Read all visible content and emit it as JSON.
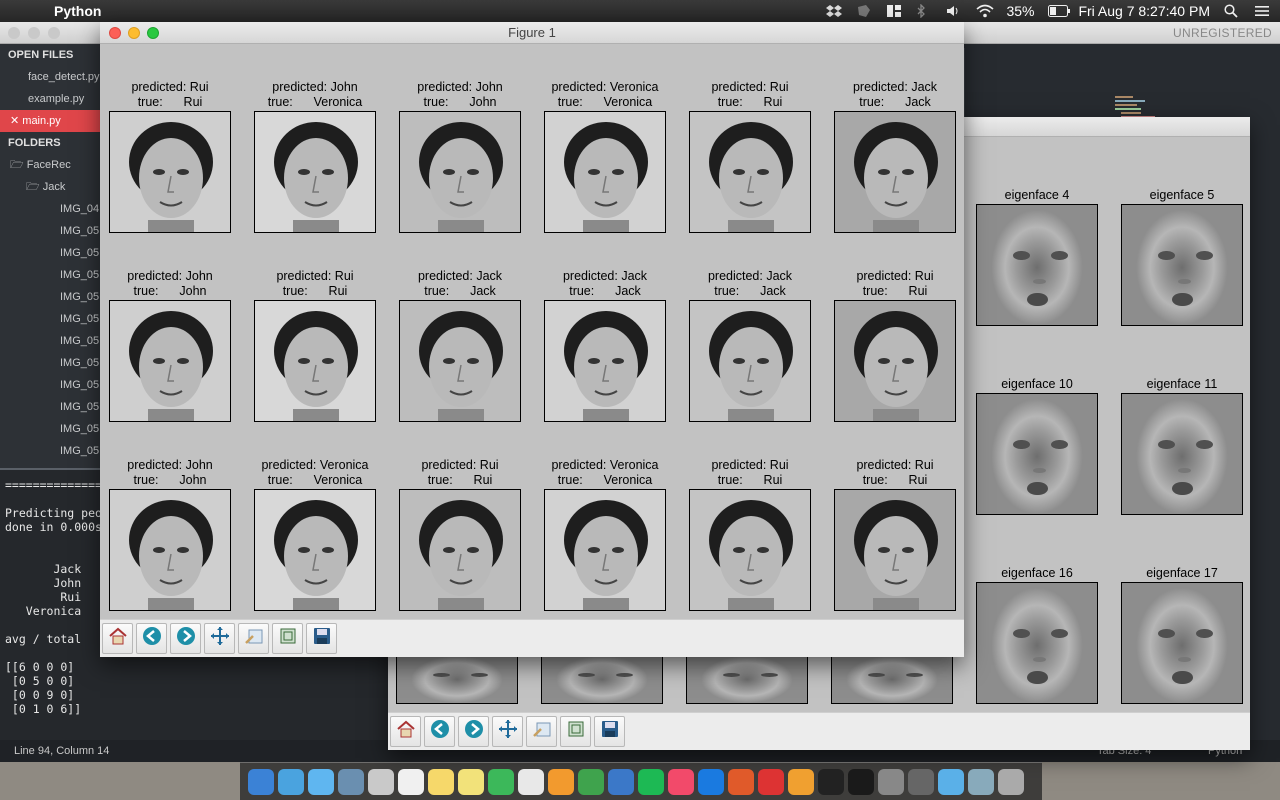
{
  "menubar": {
    "app_name": "Python",
    "battery": "35%",
    "clock": "Fri Aug 7  8:27:40 PM"
  },
  "editor": {
    "unregistered": "UNREGISTERED",
    "sidebar": {
      "open_files_header": "OPEN FILES",
      "open_files": [
        "face_detect.py",
        "example.py",
        "main.py"
      ],
      "active_file": "main.py",
      "folders_header": "FOLDERS",
      "folder_root": "FaceRec",
      "folder_child": "Jack",
      "files": [
        "IMG_04",
        "IMG_05",
        "IMG_05",
        "IMG_05",
        "IMG_05",
        "IMG_05",
        "IMG_05",
        "IMG_05",
        "IMG_05",
        "IMG_05",
        "IMG_05",
        "IMG_05",
        "IMG_05"
      ]
    },
    "console_text": "==================\n\nPredicting peo\ndone in 0.000s\n              P\n\n       Jack\n       John\n        Rui\n   Veronica\n\navg / total\n\n[[6 0 0 0]\n [0 5 0 0]\n [0 0 9 0]\n [0 1 0 6]]",
    "status_left": "Line 94, Column 14",
    "status_tabsize": "Tab Size: 4",
    "status_syntax": "Python"
  },
  "figure1": {
    "title": "Figure 1",
    "panels": [
      {
        "predicted": "predicted: Rui",
        "true": "true:      Rui"
      },
      {
        "predicted": "predicted: John",
        "true": "true:      Veronica"
      },
      {
        "predicted": "predicted: John",
        "true": "true:      John"
      },
      {
        "predicted": "predicted: Veronica",
        "true": "true:      Veronica"
      },
      {
        "predicted": "predicted: Rui",
        "true": "true:      Rui"
      },
      {
        "predicted": "predicted: Jack",
        "true": "true:      Jack"
      },
      {
        "predicted": "predicted: John",
        "true": "true:      John"
      },
      {
        "predicted": "predicted: Rui",
        "true": "true:      Rui"
      },
      {
        "predicted": "predicted: Jack",
        "true": "true:      Jack"
      },
      {
        "predicted": "predicted: Jack",
        "true": "true:      Jack"
      },
      {
        "predicted": "predicted: Jack",
        "true": "true:      Jack"
      },
      {
        "predicted": "predicted: Rui",
        "true": "true:      Rui"
      },
      {
        "predicted": "predicted: John",
        "true": "true:      John"
      },
      {
        "predicted": "predicted: Veronica",
        "true": "true:      Veronica"
      },
      {
        "predicted": "predicted: Rui",
        "true": "true:      Rui"
      },
      {
        "predicted": "predicted: Veronica",
        "true": "true:      Veronica"
      },
      {
        "predicted": "predicted: Rui",
        "true": "true:      Rui"
      },
      {
        "predicted": "predicted: Rui",
        "true": "true:      Rui"
      }
    ],
    "toolbar": [
      "home-icon",
      "back-arrow-icon",
      "forward-arrow-icon",
      "pan-icon",
      "zoom-icon",
      "subplots-icon",
      "save-icon"
    ]
  },
  "figure2": {
    "eigenface_labels": [
      "eigenface 4",
      "eigenface 5",
      "eigenface 10",
      "eigenface 11",
      "eigenface 16",
      "eigenface 17"
    ],
    "toolbar": [
      "home-icon",
      "back-arrow-icon",
      "forward-arrow-icon",
      "pan-icon",
      "zoom-icon",
      "subplots-icon",
      "save-icon"
    ]
  },
  "dock_apps": [
    "Finder",
    "Safari",
    "Messages",
    "Preview",
    "Photos",
    "Calendar",
    "Notes",
    "Stickies",
    "FaceTime",
    "TextEdit",
    "Pages",
    "Numbers",
    "Keynote",
    "Spotify",
    "iTunes",
    "Xcode",
    "MATLAB",
    "Mathematica",
    "Sublime Text",
    "Terminal",
    "Activity Monitor",
    "System Preferences",
    "Pencil",
    "Folder",
    "Mail",
    "Trash"
  ],
  "colors": {
    "active_file_bg": "#e0464a",
    "figure_bg": "#c2c2c2",
    "editor_bg": "#272b30"
  }
}
